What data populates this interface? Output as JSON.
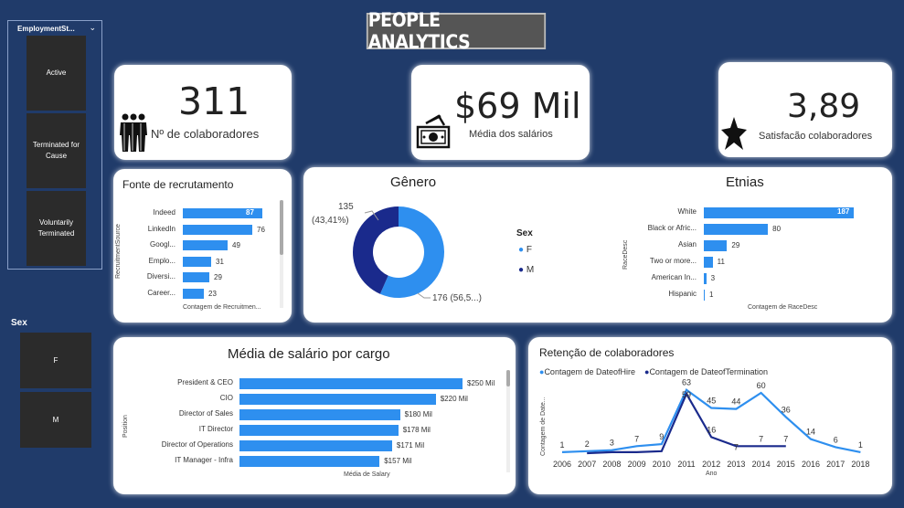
{
  "header": {
    "title": "PEOPLE ANALYTICS"
  },
  "slicer_status": {
    "title": "EmploymentSt...",
    "items": [
      "Active",
      "Terminated for Cause",
      "Voluntarily Terminated"
    ]
  },
  "slicer_sex": {
    "title": "Sex",
    "items": [
      "F",
      "M"
    ]
  },
  "kpis": {
    "employees": {
      "value": "311",
      "label": "Nº de colaboradores",
      "icon": "people-icon"
    },
    "salary": {
      "value": "$69 Mil",
      "label": "Média dos salários",
      "icon": "money-icon"
    },
    "satisfaction": {
      "value": "3,89",
      "label": "Satisfacão colaboradores",
      "icon": "star-icon"
    }
  },
  "colors": {
    "primary": "#2E8FEF",
    "secondary": "#1A2A8C",
    "background": "#203B6A"
  },
  "recruitment": {
    "title": "Fonte de recrutamento",
    "ylabel": "RecruitmentSource",
    "xlabel": "Contagem de Recruitmen...",
    "categories": [
      "Indeed",
      "LinkedIn",
      "Googl...",
      "Emplo...",
      "Diversi...",
      "Career..."
    ],
    "values": [
      87,
      76,
      49,
      31,
      29,
      23
    ]
  },
  "gender": {
    "title": "Gênero",
    "legend_title": "Sex",
    "legend": [
      "F",
      "M"
    ],
    "label_m": "135",
    "label_m_pct": "(43,41%)",
    "label_f": "176 (56,5...)",
    "values": {
      "F": 176,
      "M": 135
    }
  },
  "ethnicity": {
    "title": "Etnias",
    "ylabel": "RaceDesc",
    "xlabel": "Contagem de RaceDesc",
    "categories": [
      "White",
      "Black or Afric...",
      "Asian",
      "Two or more...",
      "American In...",
      "Hispanic"
    ],
    "values": [
      187,
      80,
      29,
      11,
      3,
      1
    ]
  },
  "salary_position": {
    "title": "Média de salário por cargo",
    "ylabel": "Position",
    "xlabel": "Média de Salary",
    "categories": [
      "President & CEO",
      "CIO",
      "Director of Sales",
      "IT Director",
      "Director of Operations",
      "IT Manager - Infra"
    ],
    "value_labels": [
      "$250 Mil",
      "$220 Mil",
      "$180 Mil",
      "$178 Mil",
      "$171 Mil",
      "$157 Mil"
    ],
    "values": [
      250,
      220,
      180,
      178,
      171,
      157
    ]
  },
  "retention": {
    "title": "Retenção de colaboradores",
    "legend": [
      "Contagem de DateofHire",
      "Contagem de DateofTermination"
    ],
    "ylabel": "Contagem de Date...",
    "xlabel": "Ano",
    "years": [
      "2006",
      "2007",
      "2008",
      "2009",
      "2010",
      "2011",
      "2012",
      "2013",
      "2014",
      "2015",
      "2016",
      "2017",
      "2018"
    ],
    "hire": [
      1,
      2,
      3,
      7,
      9,
      63,
      45,
      44,
      60,
      36,
      14,
      6,
      1
    ],
    "hire_labels": [
      "1",
      "2",
      "3",
      "7",
      "9",
      "63",
      "45",
      "44",
      "60",
      "36",
      "14",
      "6",
      "1"
    ],
    "termination": [
      null,
      0,
      1,
      1,
      2,
      59,
      16,
      7,
      7,
      7,
      null,
      null,
      null
    ],
    "termination_labels": [
      "",
      "",
      "",
      "",
      "",
      "59",
      "16",
      "7",
      "7",
      "7",
      "",
      "",
      ""
    ]
  },
  "chart_data": [
    {
      "type": "bar",
      "title": "Fonte de recrutamento",
      "xlabel": "Contagem de Recruitmen...",
      "ylabel": "RecruitmentSource",
      "categories": [
        "Indeed",
        "LinkedIn",
        "Googl...",
        "Emplo...",
        "Diversi...",
        "Career..."
      ],
      "values": [
        87,
        76,
        49,
        31,
        29,
        23
      ]
    },
    {
      "type": "pie",
      "title": "Gênero",
      "categories": [
        "F",
        "M"
      ],
      "values": [
        176,
        135
      ]
    },
    {
      "type": "bar",
      "title": "Etnias",
      "xlabel": "Contagem de RaceDesc",
      "ylabel": "RaceDesc",
      "categories": [
        "White",
        "Black or Afric...",
        "Asian",
        "Two or more...",
        "American In...",
        "Hispanic"
      ],
      "values": [
        187,
        80,
        29,
        11,
        3,
        1
      ]
    },
    {
      "type": "bar",
      "title": "Média de salário por cargo",
      "xlabel": "Média de Salary",
      "ylabel": "Position",
      "categories": [
        "President & CEO",
        "CIO",
        "Director of Sales",
        "IT Director",
        "Director of Operations",
        "IT Manager - Infra"
      ],
      "values": [
        250,
        220,
        180,
        178,
        171,
        157
      ]
    },
    {
      "type": "line",
      "title": "Retenção de colaboradores",
      "xlabel": "Ano",
      "ylabel": "Contagem de Date...",
      "x": [
        "2006",
        "2007",
        "2008",
        "2009",
        "2010",
        "2011",
        "2012",
        "2013",
        "2014",
        "2015",
        "2016",
        "2017",
        "2018"
      ],
      "series": [
        {
          "name": "Contagem de DateofHire",
          "values": [
            1,
            2,
            3,
            7,
            9,
            63,
            45,
            44,
            60,
            36,
            14,
            6,
            1
          ]
        },
        {
          "name": "Contagem de DateofTermination",
          "values": [
            null,
            0,
            1,
            1,
            2,
            59,
            16,
            7,
            7,
            7,
            null,
            null,
            null
          ]
        }
      ]
    }
  ]
}
